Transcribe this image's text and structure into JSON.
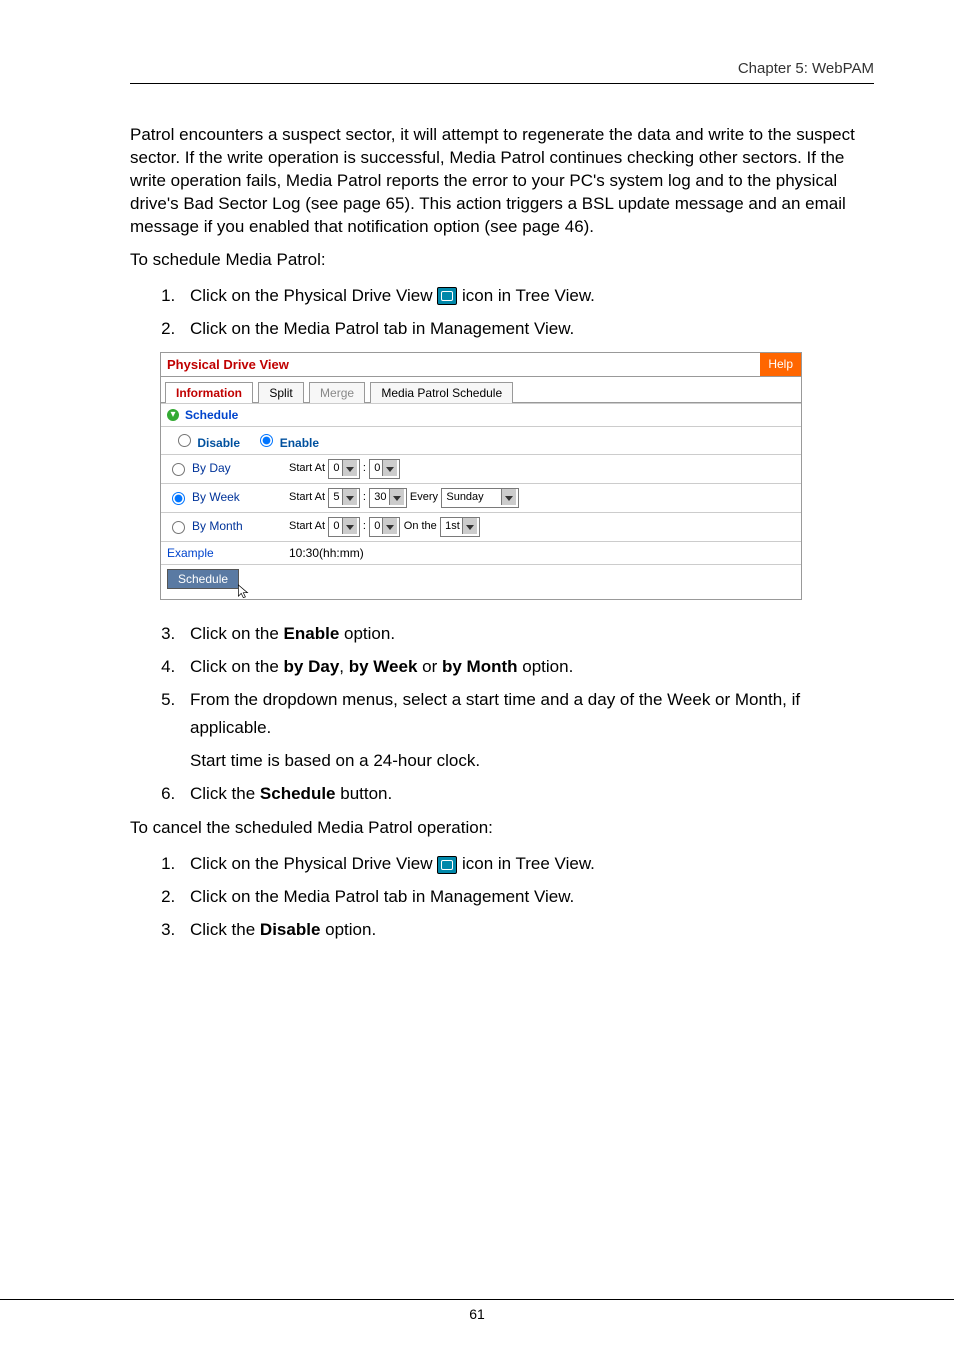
{
  "header": {
    "chapter": "Chapter 5: WebPAM"
  },
  "intro": "Patrol encounters a suspect sector, it will attempt to regenerate the data and write to the suspect sector. If the write operation is successful, Media Patrol continues checking other sectors. If the write operation fails, Media Patrol reports the error to your PC's system log and to the physical drive's Bad Sector Log (see page 65). This action triggers a BSL update message and an email message if you enabled that notification option (see page 46).",
  "schedule_text": "To schedule Media Patrol:",
  "steps_a": {
    "s1_pre": "Click on the Physical Drive View ",
    "s1_post": " icon in Tree View.",
    "s2": "Click on the Media Patrol tab in Management View."
  },
  "panel": {
    "title": "Physical Drive View",
    "help": "Help",
    "tabs": {
      "information": "Information",
      "split": "Split",
      "merge": "Merge",
      "media_patrol": "Media Patrol Schedule"
    },
    "section_label": "Schedule",
    "disable": "Disable",
    "enable": "Enable",
    "rows": {
      "by_day": "By Day",
      "by_week": "By Week",
      "by_month": "By Month",
      "start_at": "Start At",
      "every": "Every",
      "on_the": "On the",
      "day_hour": "0",
      "day_min": "0",
      "week_hour": "5",
      "week_min": "30",
      "week_day": "Sunday",
      "month_hour": "0",
      "month_min": "0",
      "month_day": "1st",
      "example_label": "Example",
      "example_value": "10:30(hh:mm)"
    },
    "button": "Schedule"
  },
  "steps_b": {
    "s3_pre": "Click on the ",
    "s3_b": "Enable",
    "s3_post": " option.",
    "s4_pre": "Click on the ",
    "s4_b1": "by Day",
    "s4_mid1": ", ",
    "s4_b2": "by Week",
    "s4_mid2": " or ",
    "s4_b3": "by Month",
    "s4_post": " option.",
    "s5": "From the dropdown menus, select a start time and a day of the Week or Month, if applicable.",
    "s5_note": "Start time is based on a 24-hour clock.",
    "s6_pre": "Click the ",
    "s6_b": "Schedule",
    "s6_post": " button."
  },
  "cancel_text": "To cancel the scheduled Media Patrol operation:",
  "steps_c": {
    "s1_pre": "Click on the Physical Drive View ",
    "s1_post": " icon in Tree View.",
    "s2": "Click on the Media Patrol tab in Management View.",
    "s3_pre": "Click the ",
    "s3_b": "Disable",
    "s3_post": " option."
  },
  "footer": "61"
}
